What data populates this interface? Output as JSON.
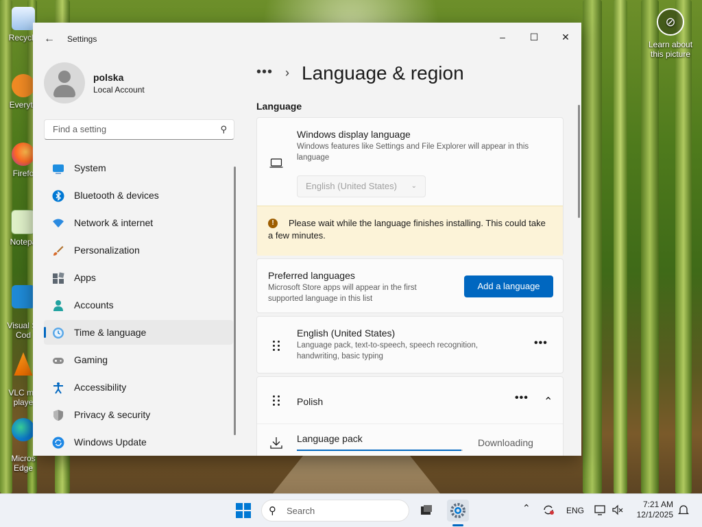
{
  "desktop": {
    "icons": [
      {
        "label": "Recycle",
        "icon": "recycle-bin-icon"
      },
      {
        "label": "Everyth",
        "icon": "everything-icon"
      },
      {
        "label": "Firefo",
        "icon": "firefox-icon"
      },
      {
        "label": "Notepa",
        "icon": "notepad-icon"
      },
      {
        "label": "Visual St\nCod",
        "icon": "vscode-icon"
      },
      {
        "label": "VLC me\nplaye",
        "icon": "vlc-icon"
      },
      {
        "label": "Micros\nEdge",
        "icon": "edge-icon"
      }
    ],
    "learn": "Learn about this picture"
  },
  "window": {
    "title": "Settings",
    "controls": {
      "minimize": "–",
      "maximize": "☐",
      "close": "✕"
    }
  },
  "profile": {
    "name": "polska",
    "type": "Local Account"
  },
  "search": {
    "placeholder": "Find a setting"
  },
  "nav": {
    "items": [
      {
        "label": "System",
        "icon": "system-icon",
        "color": "#0078d4"
      },
      {
        "label": "Bluetooth & devices",
        "icon": "bluetooth-icon",
        "color": "#0078d4"
      },
      {
        "label": "Network & internet",
        "icon": "network-icon",
        "color": "#1e88e5"
      },
      {
        "label": "Personalization",
        "icon": "brush-icon",
        "color": "#d86b2b"
      },
      {
        "label": "Apps",
        "icon": "apps-icon",
        "color": "#5c6670"
      },
      {
        "label": "Accounts",
        "icon": "accounts-icon",
        "color": "#21a2a0"
      },
      {
        "label": "Time & language",
        "icon": "time-language-icon",
        "color": "#0078d4"
      },
      {
        "label": "Gaming",
        "icon": "gaming-icon",
        "color": "#6b6b6b"
      },
      {
        "label": "Accessibility",
        "icon": "accessibility-icon",
        "color": "#0067c0"
      },
      {
        "label": "Privacy & security",
        "icon": "shield-icon",
        "color": "#7a7a7a"
      },
      {
        "label": "Windows Update",
        "icon": "update-icon",
        "color": "#0078d4"
      }
    ],
    "active_index": 6
  },
  "main": {
    "breadcrumb_more": "•••",
    "breadcrumb_sep": "›",
    "title": "Language & region",
    "section": "Language",
    "display_language": {
      "title": "Windows display language",
      "subtitle": "Windows features like Settings and File Explorer will appear in this language",
      "selected": "English (United States)"
    },
    "warning": {
      "icon": "!",
      "text": "Please wait while the language finishes installing. This could take a few minutes."
    },
    "preferred": {
      "title": "Preferred languages",
      "subtitle": "Microsoft Store apps will appear in the first supported language in this list",
      "button": "Add a language"
    },
    "languages": [
      {
        "name": "English (United States)",
        "details": "Language pack, text-to-speech, speech recognition, handwriting, basic typing"
      },
      {
        "name": "Polish",
        "details": ""
      }
    ],
    "more": "•••",
    "collapse": "⌃",
    "language_pack": {
      "label": "Language pack",
      "status": "Downloading",
      "progress": 0.99
    }
  },
  "taskbar": {
    "search_label": "Search",
    "tray": {
      "chevron": "⌃",
      "lang": "ENG"
    },
    "time": "7:21 AM",
    "date": "12/1/2025"
  },
  "colors": {
    "accent": "#0067c0",
    "warning_bg": "#fcf3d8"
  }
}
